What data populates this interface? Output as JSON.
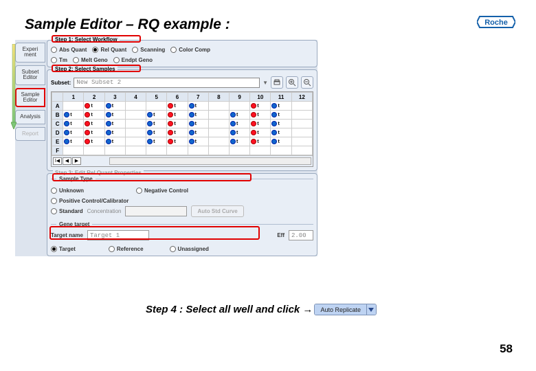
{
  "slide": {
    "title": "Sample Editor – RQ example :",
    "page_number": "58",
    "step4_text": "Step 4 :  Select all well and click →"
  },
  "logo": {
    "name": "Roche"
  },
  "side_tabs": [
    {
      "label": "Experi ment"
    },
    {
      "label": "Subset Editor"
    },
    {
      "label": "Sample Editor"
    },
    {
      "label": "Analysis"
    },
    {
      "label": "Report"
    }
  ],
  "step1": {
    "legend": "Step 1: Select Workflow",
    "options_row1": [
      "Abs Quant",
      "Rel Quant",
      "Scanning",
      "Color Comp"
    ],
    "options_row2": [
      "Tm",
      "Melt Geno",
      "Endpt Geno"
    ],
    "selected": "Rel Quant"
  },
  "step2": {
    "legend": "Step 2: Select Samples",
    "subset_label": "Subset:",
    "subset_value": "New Subset 2",
    "col_headers": [
      "1",
      "2",
      "3",
      "4",
      "5",
      "6",
      "7",
      "8",
      "9",
      "10",
      "11",
      "12"
    ],
    "row_headers": [
      "A",
      "B",
      "C",
      "D",
      "E",
      "F"
    ],
    "cell_label": "t"
  },
  "step3": {
    "legend": "Step 3: Edit Rel Quant Properties",
    "sample_type_label": "Sample Type",
    "type_opts": [
      "Unknown",
      "Negative Control",
      "Positive Control/Calibrator",
      "Standard"
    ],
    "conc_label": "Concentration",
    "auto_std_label": "Auto Std Curve",
    "gene_target_label": "Gene target",
    "target_name_label": "Target name",
    "target_name_value": "Target 1",
    "eff_label": "Eff",
    "eff_value": "2.00",
    "target_opts": [
      "Target",
      "Reference",
      "Unassigned"
    ]
  },
  "auto_replicate_label": "Auto Replicate"
}
